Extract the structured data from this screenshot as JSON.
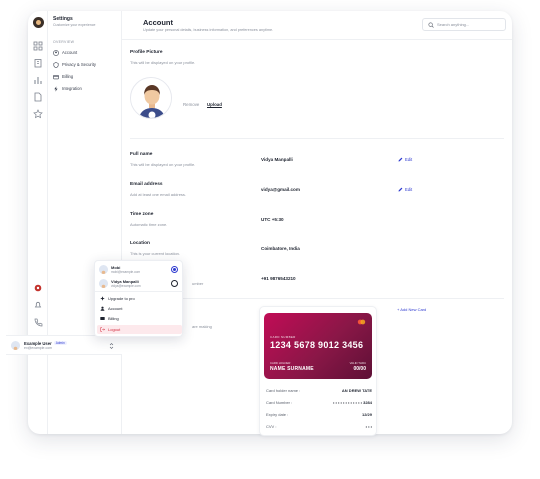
{
  "sidebar": {
    "title": "Settings",
    "subtitle": "Customize your experience",
    "section_label": "OVERVIEW",
    "items": [
      {
        "label": "Account",
        "icon": "user-icon"
      },
      {
        "label": "Privacy & Security",
        "icon": "shield-icon"
      },
      {
        "label": "Billing",
        "icon": "card-icon"
      },
      {
        "label": "Integration",
        "icon": "bolt-icon"
      }
    ]
  },
  "header": {
    "title": "Account",
    "subtitle": "Update your personal details, business information, and preferences anytime.",
    "search_placeholder": "Search anything..."
  },
  "profile": {
    "label": "Profile Picture",
    "hint": "This will be displayed on your profile.",
    "remove_label": "Remove",
    "upload_label": "Upload"
  },
  "fields": [
    {
      "label": "Full name",
      "hint": "This will be displayed on your profile.",
      "value": "Vidya Manpalli",
      "edit": "Edit"
    },
    {
      "label": "Email address",
      "hint": "Add at least one email address.",
      "value": "vidya@gmail.com",
      "edit": "Edit"
    },
    {
      "label": "Time zone",
      "hint": "Automatic time zone.",
      "value": "UTC +5:30"
    },
    {
      "label": "Location",
      "hint": "This is your current location.",
      "value": "Coimbatore, India"
    },
    {
      "label": "",
      "hint": "umber",
      "value": "+91 9876543210"
    }
  ],
  "payment": {
    "hint_partial": "are making",
    "add_card_label": "+ Add New Card",
    "card": {
      "number_label": "CARD NUMBER",
      "number": "1234 5678 9012 3456",
      "holder_label": "CARD HOLDER",
      "holder": "NAME SURNAME",
      "valid_label": "VALID THRU",
      "valid": "00/00"
    },
    "details": [
      {
        "label": "Card holder name :",
        "value": "AN DREW TATE"
      },
      {
        "label": "Card Number :",
        "value": "• • • • • • • • • • • • 3284"
      },
      {
        "label": "Expiry date :",
        "value": "12/29"
      },
      {
        "label": "CVV :",
        "value": "• • •"
      }
    ]
  },
  "user": {
    "name": "Example User",
    "badge": "Admin",
    "email": "ex@example.com"
  },
  "popup": {
    "accounts": [
      {
        "name": "Mobi",
        "email": "mobi@example.com",
        "selected": true
      },
      {
        "name": "Vidya Manpalli",
        "email": "vidya@example.com",
        "selected": false
      }
    ],
    "items": [
      {
        "label": "Upgrade to pro",
        "icon": "sparkle-icon"
      },
      {
        "label": "Account",
        "icon": "user-icon"
      },
      {
        "label": "Billing",
        "icon": "card-icon"
      },
      {
        "label": "Logout",
        "icon": "logout-icon"
      }
    ]
  },
  "colors": {
    "accent": "#2f3bd0",
    "card_gradient_start": "#c10c56",
    "card_gradient_end": "#5e1036",
    "logout": "#d22a3d"
  }
}
